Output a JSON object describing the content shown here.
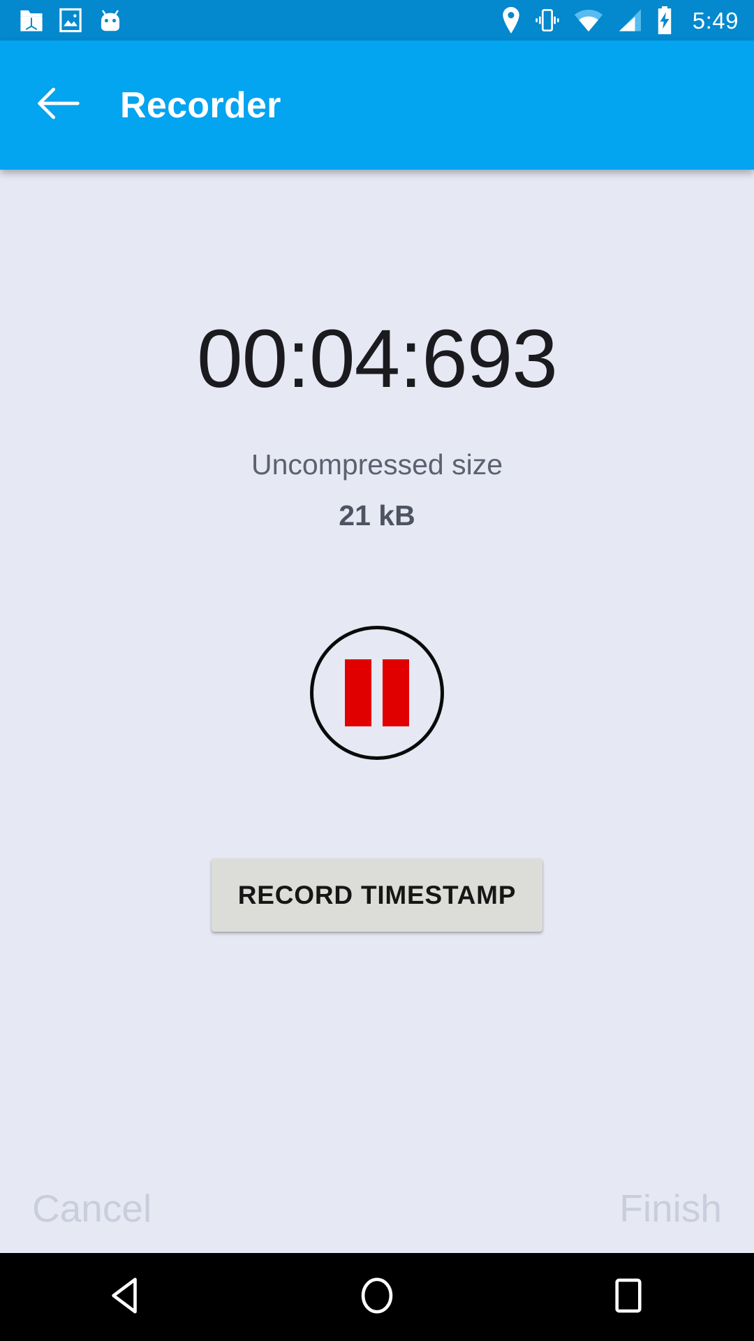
{
  "status_bar": {
    "background_color": "#0488CE",
    "clock": "5:49",
    "left_icons": [
      {
        "name": "folder-3d-axis-icon",
        "label": "File manager notification"
      },
      {
        "name": "image-icon",
        "label": "Screenshot / gallery notification"
      },
      {
        "name": "android-head-icon",
        "label": "Android system notification"
      }
    ],
    "right_icons": [
      {
        "name": "location-pin-icon",
        "label": "Location active"
      },
      {
        "name": "vibrate-icon",
        "label": "Ringer set to vibrate"
      },
      {
        "name": "wifi-icon",
        "label": "Wi-Fi connected"
      },
      {
        "name": "cell-signal-icon",
        "label": "Mobile signal"
      },
      {
        "name": "battery-charging-icon",
        "label": "Battery charging"
      }
    ]
  },
  "app_bar": {
    "background_color": "#03A4F0",
    "title": "Recorder",
    "back_icon": "arrow-left-icon"
  },
  "main": {
    "background_color": "#E6E8F4",
    "timer": "00:04:693",
    "size_label": "Uncompressed size",
    "size_value": "21 kB",
    "record_control": {
      "icon": "pause-icon",
      "state": "recording",
      "accent_color": "#E00000",
      "outline_color": "#0A0A0A"
    },
    "timestamp_button": {
      "label": "RECORD TIMESTAMP",
      "background_color": "#DCDDD8",
      "text_color": "#161616"
    }
  },
  "actions": {
    "cancel_label": "Cancel",
    "finish_label": "Finish",
    "disabled_color": "#C9CDDC"
  },
  "nav_bar": {
    "background_color": "#000000",
    "buttons": [
      {
        "name": "nav-back-button",
        "icon": "triangle-left-icon"
      },
      {
        "name": "nav-home-button",
        "icon": "circle-icon"
      },
      {
        "name": "nav-recents-button",
        "icon": "square-icon"
      }
    ]
  }
}
